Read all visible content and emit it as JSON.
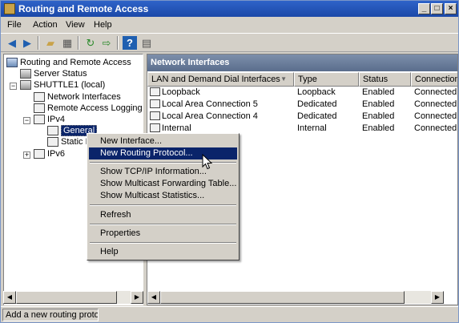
{
  "window": {
    "title": "Routing and Remote Access",
    "controls": [
      "_",
      "□",
      "×"
    ]
  },
  "menubar": [
    "File",
    "Action",
    "View",
    "Help"
  ],
  "toolbar": {
    "icons": [
      "back-arrow-icon",
      "forward-arrow-icon",
      "up-folder-icon",
      "show-hide-tree-icon",
      "refresh-icon",
      "export-list-icon",
      "help-icon",
      "properties-icon"
    ]
  },
  "tree": {
    "root": "Routing and Remote Access",
    "server_status": "Server Status",
    "server": "SHUTTLE1 (local)",
    "network_interfaces": "Network Interfaces",
    "remote_access_logging": "Remote Access Logging & P",
    "ipv4": "IPv4",
    "general": "General",
    "static_routes": "Static R",
    "ipv6": "IPv6"
  },
  "right_pane": {
    "header": "Network Interfaces",
    "columns": [
      "LAN and Demand Dial Interfaces",
      "Type",
      "Status",
      "Connection"
    ],
    "rows": [
      {
        "name": "Loopback",
        "type": "Loopback",
        "status": "Enabled",
        "connection": "Connected"
      },
      {
        "name": "Local Area Connection 5",
        "type": "Dedicated",
        "status": "Enabled",
        "connection": "Connected"
      },
      {
        "name": "Local Area Connection 4",
        "type": "Dedicated",
        "status": "Enabled",
        "connection": "Connected"
      },
      {
        "name": "Internal",
        "type": "Internal",
        "status": "Enabled",
        "connection": "Connected"
      }
    ]
  },
  "context_menu": {
    "items": [
      "New Interface...",
      "New Routing Protocol...",
      "Show TCP/IP Information...",
      "Show Multicast Forwarding Table...",
      "Show Multicast Statistics...",
      "Refresh",
      "Properties",
      "Help"
    ],
    "highlighted": "New Routing Protocol..."
  },
  "statusbar": {
    "text": "Add a new routing protocol"
  },
  "colors": {
    "title_bar": "#1b48a8",
    "pane_header": "#5a6d8c",
    "selection": "#0a246a",
    "chrome": "#d4d0c8"
  }
}
